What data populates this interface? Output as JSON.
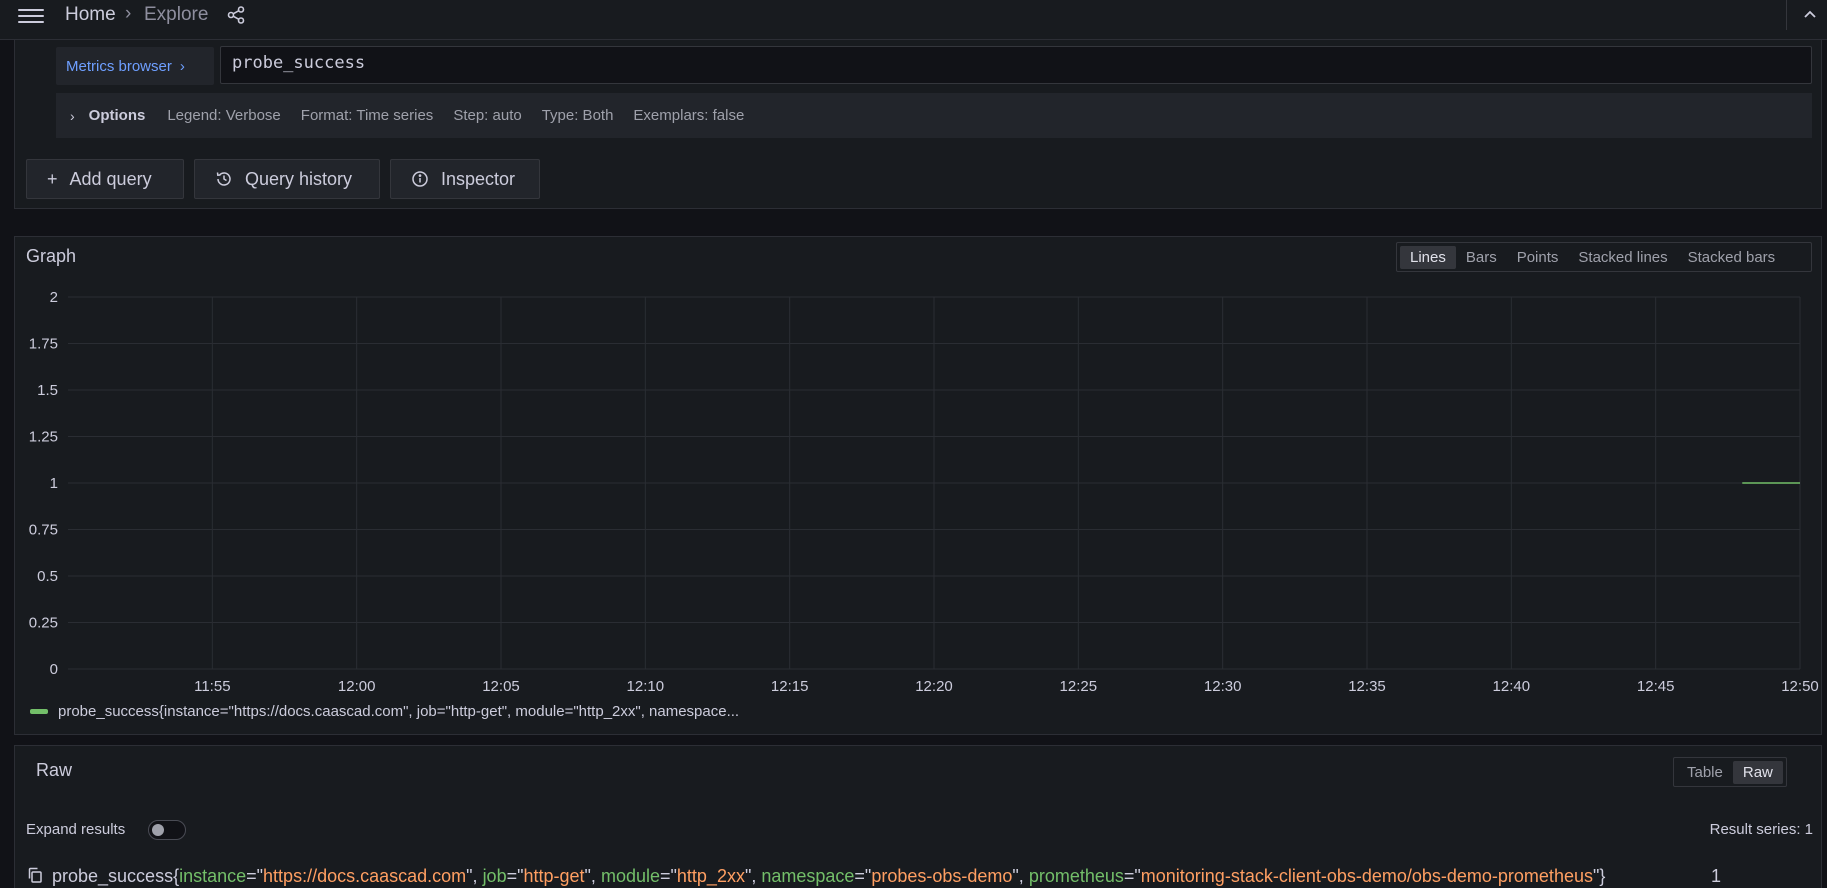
{
  "breadcrumb": {
    "home": "Home",
    "separator": "›",
    "current": "Explore"
  },
  "query": {
    "metrics_browser_label": "Metrics browser",
    "expression": "probe_success",
    "options": {
      "title": "Options",
      "legend": "Legend: Verbose",
      "format": "Format: Time series",
      "step": "Step: auto",
      "type": "Type: Both",
      "exemplars": "Exemplars: false"
    }
  },
  "actions": {
    "add_query": "Add query",
    "query_history": "Query history",
    "inspector": "Inspector"
  },
  "graph": {
    "title": "Graph",
    "modes": [
      "Lines",
      "Bars",
      "Points",
      "Stacked lines",
      "Stacked bars"
    ],
    "active_mode": "Lines",
    "legend": "probe_success{instance=\"https://docs.caascad.com\", job=\"http-get\", module=\"http_2xx\", namespace..."
  },
  "chart_data": {
    "type": "line",
    "y_ticks": [
      "2",
      "1.75",
      "1.5",
      "1.25",
      "1",
      "0.75",
      "0.5",
      "0.25",
      "0"
    ],
    "x_ticks": [
      "11:55",
      "12:00",
      "12:05",
      "12:10",
      "12:15",
      "12:20",
      "12:25",
      "12:30",
      "12:35",
      "12:40",
      "12:45",
      "12:50"
    ],
    "ylim": [
      0,
      2
    ],
    "xlim": [
      "11:50",
      "12:50"
    ],
    "grid": true,
    "series": [
      {
        "name": "probe_success{instance=\"https://docs.caascad.com\", job=\"http-get\", module=\"http_2xx\", namespace...",
        "color": "#73bf69",
        "x": [
          "12:48",
          "12:50"
        ],
        "values": [
          1,
          1
        ]
      }
    ]
  },
  "raw": {
    "title": "Raw",
    "views": [
      "Table",
      "Raw"
    ],
    "active_view": "Raw",
    "expand_label": "Expand results",
    "result_series": "Result series: 1",
    "row": {
      "metric": "probe_success",
      "labels": [
        {
          "key": "instance",
          "value": "https://docs.caascad.com"
        },
        {
          "key": "job",
          "value": "http-get"
        },
        {
          "key": "module",
          "value": "http_2xx"
        },
        {
          "key": "namespace",
          "value": "probes-obs-demo"
        },
        {
          "key": "prometheus",
          "value": "monitoring-stack-client-obs-demo/obs-demo-prometheus"
        }
      ],
      "value": "1"
    }
  },
  "colors": {
    "accent": "#6e9fff",
    "series": "#73bf69",
    "label_value": "#ff9f62"
  }
}
